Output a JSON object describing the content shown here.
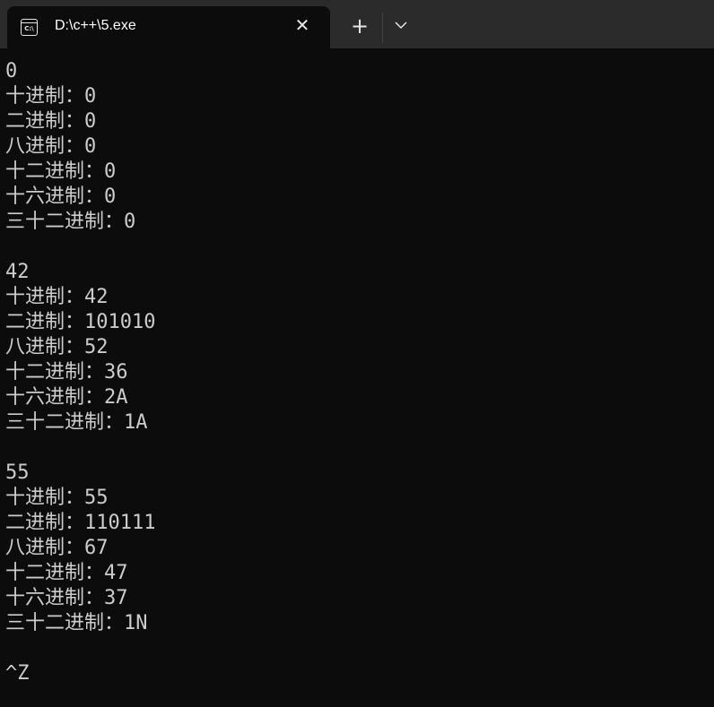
{
  "tab": {
    "title": "D:\\c++\\5.exe",
    "icon_text": "C:\\",
    "close_icon": "close-icon"
  },
  "toolbar": {
    "new_tab": "+",
    "dropdown_icon": "chevron-down-icon"
  },
  "terminal": {
    "lines": [
      "0",
      "十进制：0",
      "二进制：0",
      "八进制：0",
      "十二进制：0",
      "十六进制：0",
      "三十二进制：0",
      "",
      "42",
      "十进制：42",
      "二进制：101010",
      "八进制：52",
      "十二进制：36",
      "十六进制：2A",
      "三十二进制：1A",
      "",
      "55",
      "十进制：55",
      "二进制：110111",
      "八进制：67",
      "十二进制：47",
      "十六进制：37",
      "三十二进制：1N",
      "",
      "^Z"
    ]
  }
}
